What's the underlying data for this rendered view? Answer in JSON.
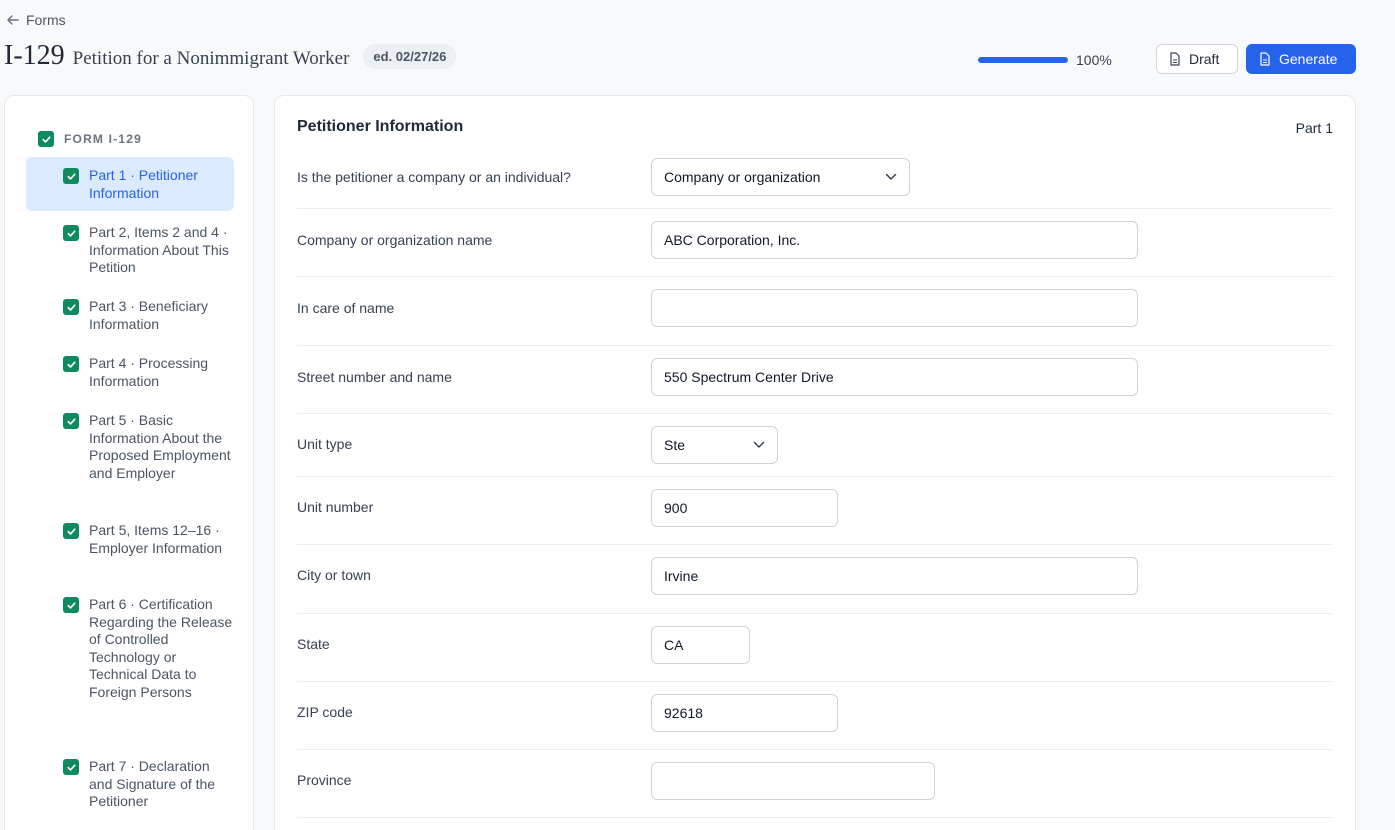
{
  "nav": {
    "back_label": "Forms"
  },
  "header": {
    "form_code": "I-129",
    "form_title": "Petition for a Nonimmigrant Worker",
    "edition": "ed. 02/27/26",
    "progress_label": "100%",
    "progress_fraction": 1.0,
    "draft_label": "Draft",
    "generate_label": "Generate",
    "accent_color": "#2563eb",
    "check_color": "#0e8a5f"
  },
  "sidebar": {
    "root_label": "FORM I-129",
    "items": [
      {
        "label": "Part 1 · Petitioner Information",
        "active": true
      },
      {
        "label": "Part 2, Items 2 and 4 · Information About This Petition"
      },
      {
        "label": "Part 3 · Beneficiary Information"
      },
      {
        "label": "Part 4 · Processing Information"
      },
      {
        "label": "Part 5 · Basic Information About the Proposed Employment and Employer"
      },
      {
        "label": "Part 5, Items 12–16 · Employer Information"
      },
      {
        "label": "Part 6 · Certification Regarding the Release of Controlled Technology or Technical Data to Foreign Persons"
      },
      {
        "label": "Part 7 · Declaration and Signature of the Petitioner"
      }
    ]
  },
  "main": {
    "section_title": "Petitioner Information",
    "section_part": "Part 1",
    "fields": {
      "petitioner_type": {
        "label": "Is the petitioner a company or an individual?",
        "value": "Company or organization"
      },
      "company_name": {
        "label": "Company or organization name",
        "value": "ABC Corporation, Inc."
      },
      "in_care_of": {
        "label": "In care of name",
        "value": ""
      },
      "street": {
        "label": "Street number and name",
        "value": "550 Spectrum Center Drive"
      },
      "unit_type": {
        "label": "Unit type",
        "value": "Ste"
      },
      "unit_number": {
        "label": "Unit number",
        "value": "900"
      },
      "city": {
        "label": "City or town",
        "value": "Irvine"
      },
      "state": {
        "label": "State",
        "value": "CA"
      },
      "zip": {
        "label": "ZIP code",
        "value": "92618"
      },
      "province": {
        "label": "Province",
        "value": ""
      }
    }
  }
}
